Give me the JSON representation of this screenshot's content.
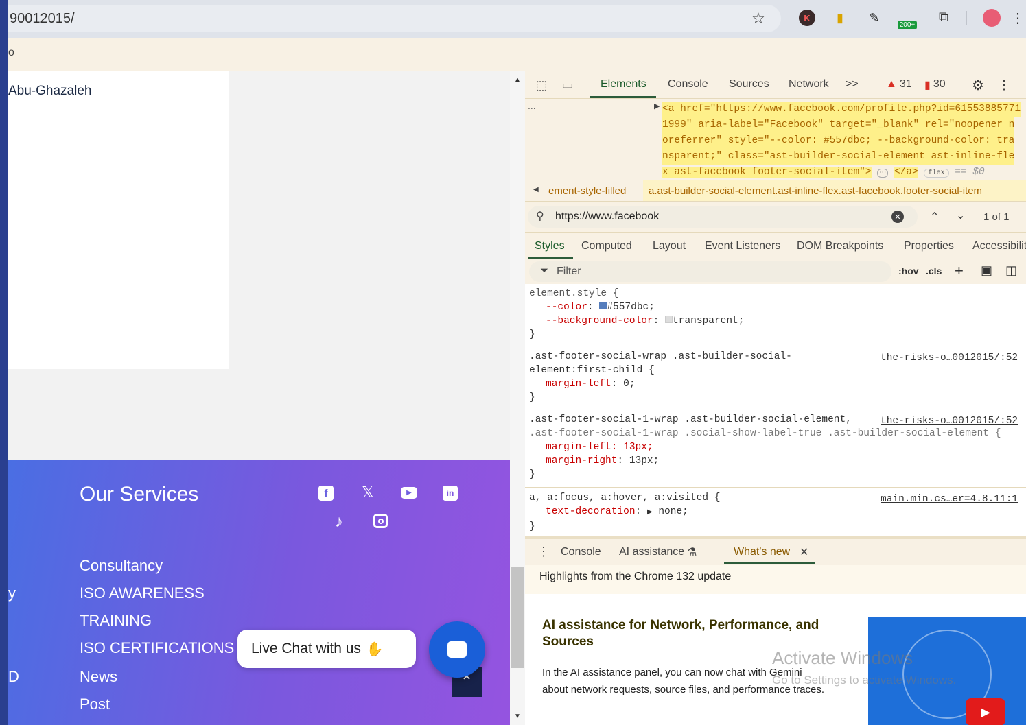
{
  "browser": {
    "url": "90012015/",
    "bookmark_fragment": "o",
    "ext_badge": "200+"
  },
  "page": {
    "heading_fragment": "",
    "author": "Abu-Ghazaleh",
    "footer": {
      "title": "Our Services",
      "links": [
        "Consultancy",
        "ISO AWARENESS",
        "TRAINING",
        "ISO CERTIFICATIONS",
        "News",
        "Post"
      ],
      "left_fragments": [
        "y",
        "D"
      ]
    },
    "live_chat": "Live Chat with us"
  },
  "devtools": {
    "tabs": [
      "Elements",
      "Console",
      "Sources",
      "Network"
    ],
    "more": ">>",
    "warnings": "31",
    "errors": "30",
    "dom": {
      "ellipsis": "...",
      "line1": "<a href=\"https://www.facebook.com/profile.php?id=61553885771",
      "line2": "1999\" aria-label=\"Facebook\" target=\"_blank\" rel=\"noopener n",
      "line3": "oreferrer\" style=\"--color: #557dbc; --background-color: tra",
      "line4": "nsparent;\" class=\"ast-builder-social-element ast-inline-fle",
      "line5": "x ast-facebook footer-social-item\">",
      "close": "</a>",
      "flex": "flex",
      "eq": "== $0"
    },
    "breadcrumb": {
      "prev": "ement-style-filled",
      "current": "a.ast-builder-social-element.ast-inline-flex.ast-facebook.footer-social-item"
    },
    "search": {
      "value": "https://www.facebook",
      "count": "1 of 1"
    },
    "subtabs": [
      "Styles",
      "Computed",
      "Layout",
      "Event Listeners",
      "DOM Breakpoints",
      "Properties",
      "Accessibilit"
    ],
    "filter": {
      "placeholder": "Filter",
      "hov": ":hov",
      "cls": ".cls"
    },
    "rules": {
      "r1": {
        "selector": "element.style {",
        "p1": "--color",
        "v1": "#557dbc;",
        "p2": "--background-color",
        "v2": "transparent;"
      },
      "r2": {
        "selector": ".ast-footer-social-wrap .ast-builder-social-",
        "selector2": "element:first-child {",
        "src": "the-risks-o…0012015/:52",
        "p1": "margin-left",
        "v1": "0;"
      },
      "r3": {
        "selector": ".ast-footer-social-1-wrap .ast-builder-social-element,",
        "selector2": ".ast-footer-social-1-wrap .social-show-label-true .ast-builder-social-element {",
        "src": "the-risks-o…0012015/:52",
        "p1": "margin-left: 13px;",
        "p2": "margin-right",
        "v2": "13px;"
      },
      "r4": {
        "selector": "a, a:focus, a:hover, a:visited {",
        "src": "main.min.cs…er=4.8.11:1",
        "p1": "text-decoration",
        "v1": "none;"
      },
      "close": "}"
    },
    "drawer": {
      "tabs": [
        "Console",
        "AI assistance",
        "What's new"
      ],
      "highlights": "Highlights from the Chrome 132 update",
      "headline": "AI assistance for Network, Performance, and Sources",
      "body": "In the AI assistance panel, you can now chat with Gemini about network requests, source files, and performance traces."
    },
    "watermark": {
      "title": "Activate Windows",
      "subtitle": "Go to Settings to activate Windows."
    }
  },
  "colors": {
    "swatch": "#557dbc",
    "accent": "#1a73e8"
  }
}
